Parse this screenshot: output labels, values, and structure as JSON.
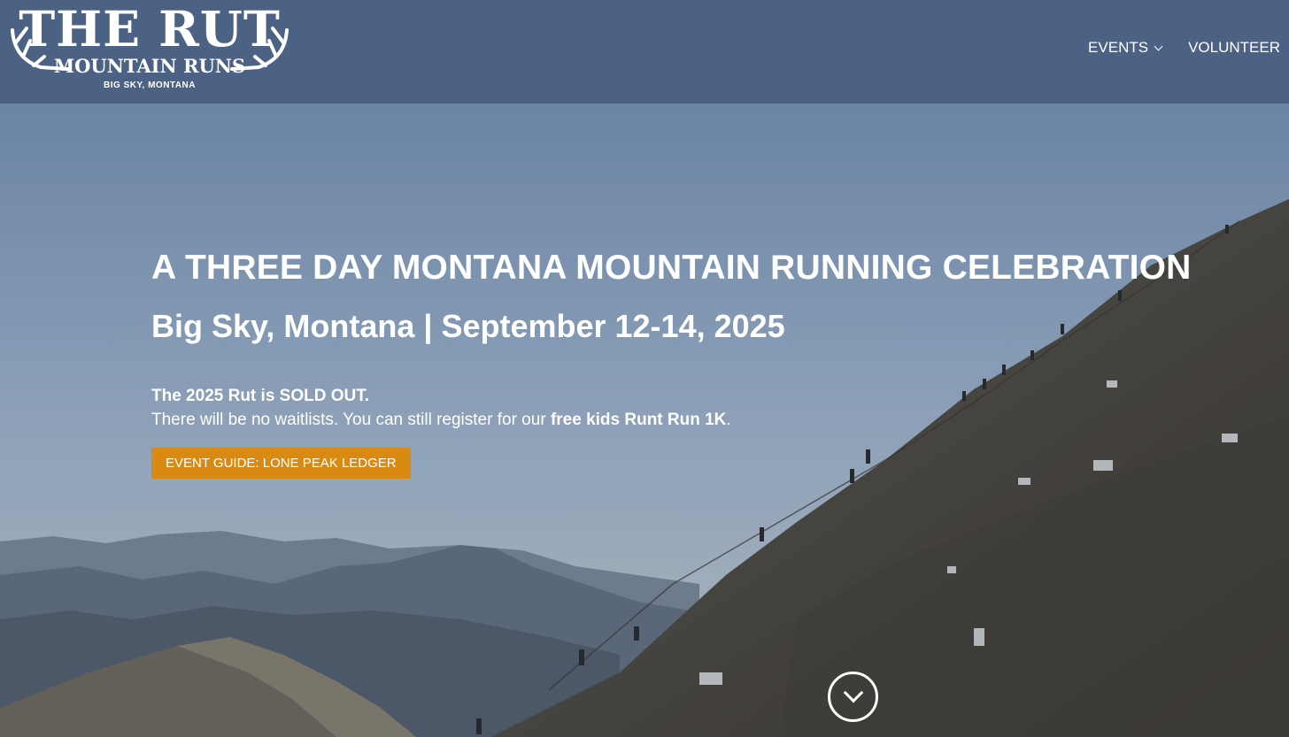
{
  "logo": {
    "title": "THE RUT",
    "subtitle": "MOUNTAIN RUNS",
    "location": "BIG SKY, MONTANA"
  },
  "nav": {
    "events": "EVENTS",
    "volunteer": "VOLUNTEER"
  },
  "hero": {
    "headline": "A THREE DAY MONTANA MOUNTAIN RUNNING CELEBRATION",
    "subhead": "Big Sky, Montana | September 12-14, 2025",
    "notice_bold": "The 2025 Rut is SOLD OUT.",
    "notice_text": "There will be no waitlists. You can still register for our ",
    "notice_link": "free kids Runt Run 1K",
    "notice_end": ".",
    "cta_label": "EVENT GUIDE: LONE PEAK LEDGER"
  },
  "icons": {
    "antler_left": "antler-icon",
    "antler_right": "antler-icon",
    "events_dropdown": "chevron-down-icon",
    "scroll": "circle-chevron-down-icon"
  },
  "colors": {
    "header": "#4a6082",
    "cta": "#d98a12",
    "sky_top": "#6f8cb3",
    "sky_bottom": "#b4c3d4",
    "mountain": "#5b5448"
  }
}
